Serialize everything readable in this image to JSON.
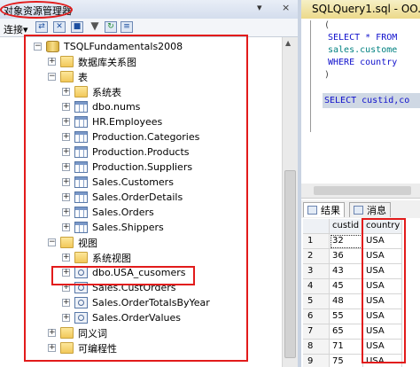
{
  "object_explorer": {
    "title": "对象资源管理器",
    "pin_glyph": "▾",
    "close_glyph": "×",
    "toolbar": {
      "connect_label": "连接",
      "connect_caret": "▾"
    },
    "tree": {
      "root": "TSQLFundamentals2008",
      "nodes": {
        "diagrams": "数据库关系图",
        "tables": "表",
        "system_tables": "系统表",
        "nums": "dbo.nums",
        "employees": "HR.Employees",
        "categories": "Production.Categories",
        "products": "Production.Products",
        "suppliers": "Production.Suppliers",
        "customers": "Sales.Customers",
        "orderdetails": "Sales.OrderDetails",
        "orders": "Sales.Orders",
        "shippers": "Sales.Shippers",
        "views": "视图",
        "system_views": "系统视图",
        "usa_cusomers": "dbo.USA_cusomers",
        "custorders": "Sales.CustOrders",
        "ordertotals": "Sales.OrderTotalsByYear",
        "ordervalues": "Sales.OrderValues",
        "synonyms": "同义词",
        "programmability": "可编程性"
      }
    }
  },
  "query_editor": {
    "tab_title": "SQLQuery1.sql - OO...",
    "code_lines": {
      "l1": "(",
      "l2": "SELECT * FROM",
      "l3": "sales.custome",
      "l4": "WHERE country",
      "l5": ")",
      "l6": "SELECT custid,co"
    }
  },
  "results": {
    "tabs": {
      "results": "结果",
      "messages": "消息"
    },
    "columns": [
      "custid",
      "country"
    ],
    "rows": [
      {
        "n": "1",
        "custid": "32",
        "country": "USA"
      },
      {
        "n": "2",
        "custid": "36",
        "country": "USA"
      },
      {
        "n": "3",
        "custid": "43",
        "country": "USA"
      },
      {
        "n": "4",
        "custid": "45",
        "country": "USA"
      },
      {
        "n": "5",
        "custid": "48",
        "country": "USA"
      },
      {
        "n": "6",
        "custid": "55",
        "country": "USA"
      },
      {
        "n": "7",
        "custid": "65",
        "country": "USA"
      },
      {
        "n": "8",
        "custid": "71",
        "country": "USA"
      },
      {
        "n": "9",
        "custid": "75",
        "country": "USA"
      }
    ]
  },
  "colors": {
    "annotation_red": "#e21b1b",
    "selection": "#cfd8e4"
  }
}
